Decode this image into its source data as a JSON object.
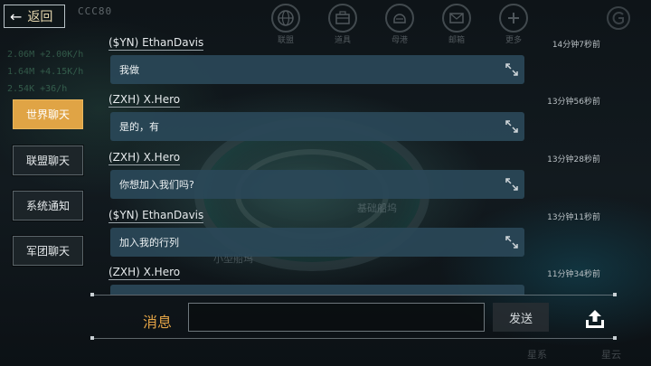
{
  "header": {
    "back_label": "返回",
    "code_text": "CCC80"
  },
  "resources": [
    "2.06M +2.00K/h",
    "1.64M +4.15K/h",
    "2.54K +36/h"
  ],
  "topnav": [
    {
      "label": "联盟",
      "icon": "globe-icon"
    },
    {
      "label": "道具",
      "icon": "toolbox-icon"
    },
    {
      "label": "母港",
      "icon": "helmet-icon"
    },
    {
      "label": "邮箱",
      "icon": "mail-icon"
    },
    {
      "label": "更多",
      "icon": "plus-circle-icon"
    }
  ],
  "tabs": [
    {
      "label": "世界聊天",
      "active": true
    },
    {
      "label": "联盟聊天",
      "active": false
    },
    {
      "label": "系统通知",
      "active": false
    },
    {
      "label": "军团聊天",
      "active": false
    }
  ],
  "messages": [
    {
      "sender": "($YN) EthanDavis",
      "time": "14分钟7秒前",
      "text": "我做"
    },
    {
      "sender": "(ZXH) X.Hero",
      "time": "13分钟56秒前",
      "text": "是的，有"
    },
    {
      "sender": "(ZXH) X.Hero",
      "time": "13分钟28秒前",
      "text": "你想加入我们吗?"
    },
    {
      "sender": "($YN) EthanDavis",
      "time": "13分钟11秒前",
      "text": "加入我的行列"
    },
    {
      "sender": "(ZXH) X.Hero",
      "time": "11分钟34秒前",
      "text": ""
    }
  ],
  "input": {
    "label": "消息",
    "value": "",
    "placeholder": "",
    "send_label": "发送"
  },
  "background_text": {
    "center_label": "基础船坞",
    "left_label": "小型船坞",
    "bottom_left": "星系",
    "bottom_right": "星云"
  },
  "colors": {
    "accent": "#e0a445",
    "bubble": "#2a4858",
    "label": "#e3a446"
  }
}
